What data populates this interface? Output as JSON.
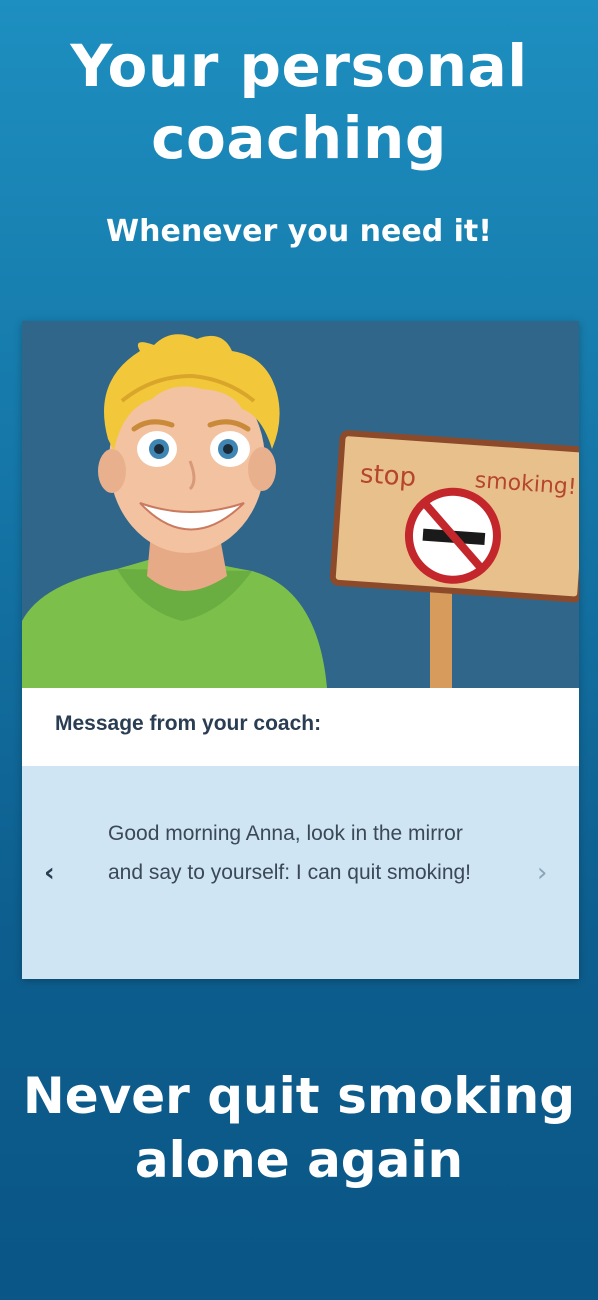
{
  "header": {
    "title": "Your personal coaching",
    "subtitle": "Whenever you need it!"
  },
  "card": {
    "illustration": {
      "sign_text_left": "stop",
      "sign_text_right": "smoking!"
    },
    "message_header": "Message from your coach:",
    "message_text": "Good morning Anna, look in the mirror and say to yourself: I can quit smoking!",
    "prev_icon": "‹",
    "next_icon": "›"
  },
  "footer": {
    "title": "Never quit smoking alone again"
  },
  "colors": {
    "illustration_bg": "#30668a",
    "message_bg": "#cfe5f4",
    "shirt": "#7cc04b",
    "hair": "#f2c83a"
  }
}
